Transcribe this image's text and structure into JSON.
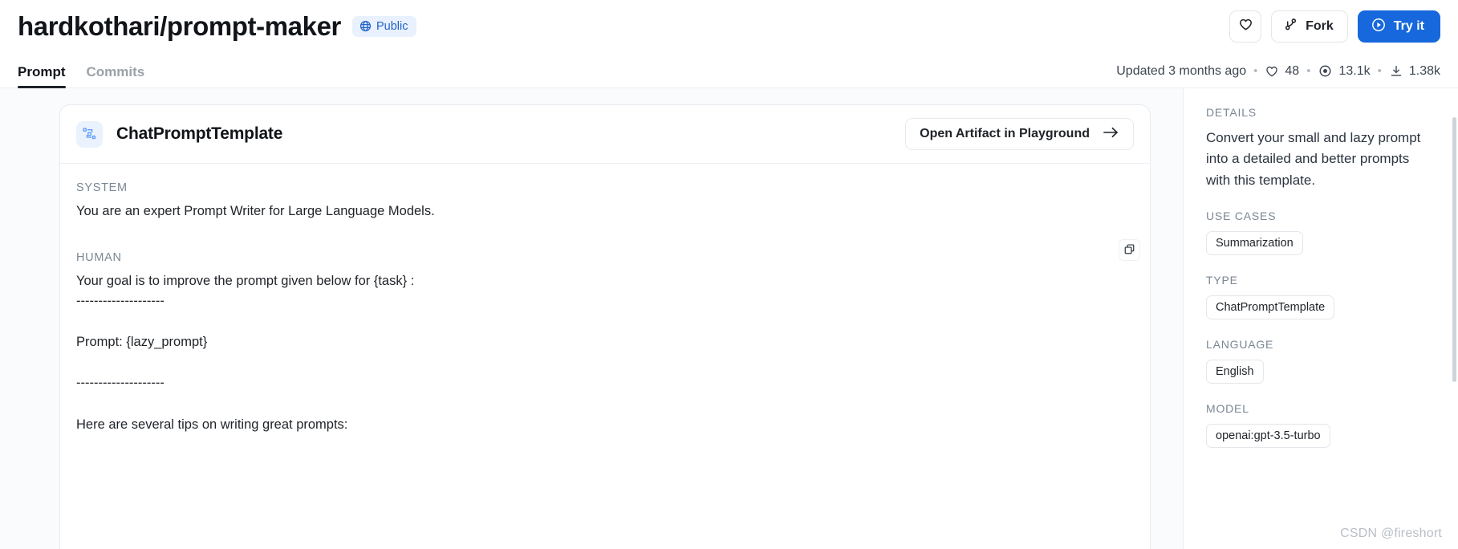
{
  "header": {
    "repo_title": "hardkothari/prompt-maker",
    "visibility_badge": "Public",
    "globe_icon": "globe-icon",
    "like_icon": "heart-icon",
    "fork_label": "Fork",
    "fork_icon": "fork-icon",
    "try_it_label": "Try it",
    "try_it_icon": "play-circle-icon"
  },
  "tabs": [
    {
      "label": "Prompt",
      "active": true
    },
    {
      "label": "Commits",
      "active": false
    }
  ],
  "stats": {
    "updated": "Updated 3 months ago",
    "separator": "•",
    "likes": "48",
    "likes_icon": "heart-icon",
    "views": "13.1k",
    "views_icon": "eye-icon",
    "downloads": "1.38k",
    "downloads_icon": "download-icon"
  },
  "card": {
    "icon": "nodes-template-icon",
    "title": "ChatPromptTemplate",
    "playground_button": "Open Artifact in Playground",
    "playground_arrow_icon": "arrow-right-icon",
    "copy_icon": "copy-icon",
    "segments": [
      {
        "role": "SYSTEM",
        "text": "You are an expert Prompt Writer for Large Language Models."
      },
      {
        "role": "HUMAN",
        "text": "Your goal is to improve the prompt given below for {task} :\n--------------------\n\nPrompt: {lazy_prompt}\n\n--------------------\n\nHere are several tips on writing great prompts:"
      }
    ]
  },
  "sidebar": {
    "details_label": "DETAILS",
    "details_text": "Convert your small and lazy prompt into a detailed and better prompts with this template.",
    "use_cases_label": "USE CASES",
    "use_cases": [
      "Summarization"
    ],
    "type_label": "TYPE",
    "type_values": [
      "ChatPromptTemplate"
    ],
    "language_label": "LANGUAGE",
    "language_values": [
      "English"
    ],
    "model_label": "MODEL",
    "model_values": [
      "openai:gpt-3.5-turbo"
    ]
  },
  "watermark": "CSDN @fireshort",
  "colors": {
    "accent": "#1668dc",
    "badge_bg": "#e8f1fd",
    "badge_text": "#2563c9",
    "muted": "#7b8794",
    "canvas": "#fafbfd"
  }
}
